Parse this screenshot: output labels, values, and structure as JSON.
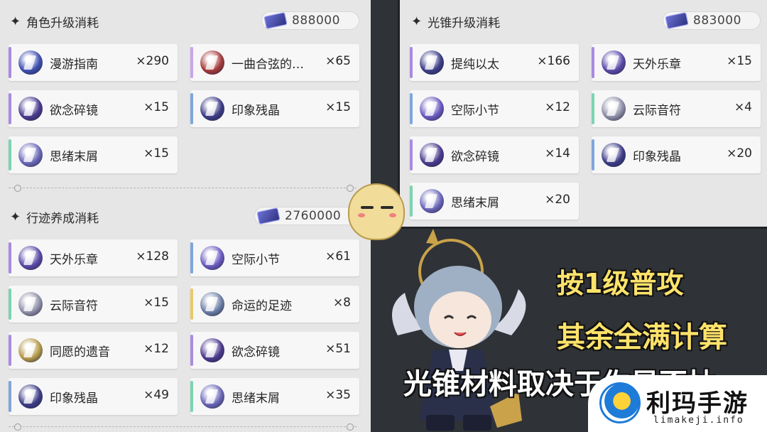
{
  "left": {
    "char_section": {
      "title": "角色升级消耗",
      "cost": "888000",
      "items": [
        {
          "name": "漫游指南",
          "qty": "×290",
          "accent": "#a98be0",
          "icon_color": "#3e4fb0",
          "icon": "book-icon"
        },
        {
          "name": "一曲合弦的…",
          "qty": "×65",
          "accent": "#c7a5ea",
          "icon_color": "#a63b3b",
          "icon": "horn-icon"
        },
        {
          "name": "欲念碎镜",
          "qty": "×15",
          "accent": "#a98be0",
          "icon_color": "#4b3a8e",
          "icon": "mirror-icon"
        },
        {
          "name": "印象残晶",
          "qty": "×15",
          "accent": "#7fa6dd",
          "icon_color": "#3d3c86",
          "icon": "crystal-icon"
        },
        {
          "name": "思绪末屑",
          "qty": "×15",
          "accent": "#7dd4b0",
          "icon_color": "#6b68b8",
          "icon": "shard-icon"
        }
      ]
    },
    "trace_section": {
      "title": "行迹养成消耗",
      "cost": "2760000",
      "items": [
        {
          "name": "天外乐章",
          "qty": "×128",
          "accent": "#a98be0",
          "icon_color": "#5a4aa8",
          "icon": "music-sheet-icon"
        },
        {
          "name": "空际小节",
          "qty": "×61",
          "accent": "#7fa6dd",
          "icon_color": "#6a5bc0",
          "icon": "music-bar-icon"
        },
        {
          "name": "云际音符",
          "qty": "×15",
          "accent": "#7dd4b0",
          "icon_color": "#8f8fa8",
          "icon": "music-note-icon"
        },
        {
          "name": "命运的足迹",
          "qty": "×8",
          "accent": "#e9c96c",
          "icon_color": "#6d7fa6",
          "icon": "footprint-icon"
        },
        {
          "name": "同愿的遗音",
          "qty": "×12",
          "accent": "#a98be0",
          "icon_color": "#b49a4a",
          "icon": "echo-icon"
        },
        {
          "name": "欲念碎镜",
          "qty": "×51",
          "accent": "#a98be0",
          "icon_color": "#4b3a8e",
          "icon": "mirror-icon"
        },
        {
          "name": "印象残晶",
          "qty": "×49",
          "accent": "#7fa6dd",
          "icon_color": "#3d3c86",
          "icon": "crystal-icon"
        },
        {
          "name": "思绪末屑",
          "qty": "×35",
          "accent": "#7dd4b0",
          "icon_color": "#6b68b8",
          "icon": "shard-icon"
        }
      ]
    }
  },
  "right": {
    "cone_section": {
      "title": "光锥升级消耗",
      "cost": "883000",
      "items": [
        {
          "name": "提纯以太",
          "qty": "×166",
          "accent": "#a98be0",
          "icon_color": "#3b3f86",
          "icon": "ether-icon"
        },
        {
          "name": "天外乐章",
          "qty": "×15",
          "accent": "#a98be0",
          "icon_color": "#5a4aa8",
          "icon": "music-sheet-icon"
        },
        {
          "name": "空际小节",
          "qty": "×12",
          "accent": "#7fa6dd",
          "icon_color": "#6a5bc0",
          "icon": "music-bar-icon"
        },
        {
          "name": "云际音符",
          "qty": "×4",
          "accent": "#7dd4b0",
          "icon_color": "#8f8fa8",
          "icon": "music-note-icon"
        },
        {
          "name": "欲念碎镜",
          "qty": "×14",
          "accent": "#a98be0",
          "icon_color": "#4b3a8e",
          "icon": "mirror-icon"
        },
        {
          "name": "印象残晶",
          "qty": "×20",
          "accent": "#7fa6dd",
          "icon_color": "#3d3c86",
          "icon": "crystal-icon"
        },
        {
          "name": "思绪末屑",
          "qty": "×20",
          "accent": "#7dd4b0",
          "icon_color": "#6b68b8",
          "icon": "shard-icon"
        }
      ]
    }
  },
  "captions": {
    "line1": "按1级普攻",
    "line2": "其余全满计算",
    "line3": "光锥材料取决于你是否抽"
  },
  "watermark": {
    "brand": "利玛手游",
    "url": "limakeji.info"
  }
}
